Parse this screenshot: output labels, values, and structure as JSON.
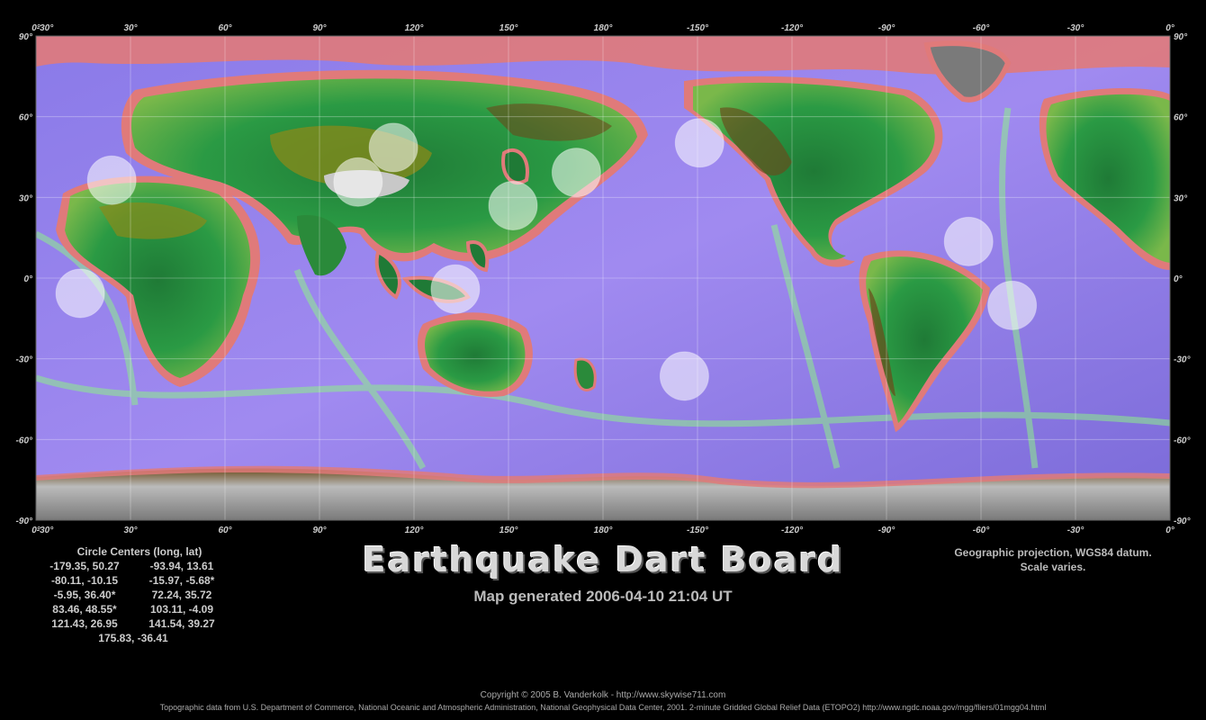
{
  "title": "Earthquake Dart Board",
  "subtitle": "Map generated 2006-04-10 21:04 UT",
  "projection_note": [
    "Geographic projection, WGS84 datum.",
    "Scale varies."
  ],
  "copyright": "Copyright © 2005 B. Vanderkolk - http://www.skywise711.com",
  "credits": "Topographic data from U.S. Department of Commerce, National Oceanic and Atmospheric Administration, National Geophysical Data Center, 2001. 2-minute Gridded Global Relief Data (ETOPO2) http://www.ngdc.noaa.gov/mgg/fliers/01mgg04.html",
  "map": {
    "longitude_ticks": [
      "-30°",
      "0°",
      "30°",
      "60°",
      "90°",
      "120°",
      "150°",
      "180°",
      "-150°",
      "-120°",
      "-90°",
      "-60°",
      "-30°",
      "0°",
      "30°"
    ],
    "latitude_ticks": [
      "90°",
      "60°",
      "30°",
      "0°",
      "-30°",
      "-60°",
      "-90°"
    ],
    "colors": {
      "ocean_deep": "#7a6ae0",
      "ocean_mid": "#a88ae8",
      "shelf": "#8ef08a",
      "coast": "#e07a7a",
      "lowland": "#1a8a3a",
      "upland": "#8a8a1a",
      "mountain": "#6a4a1a",
      "ice": "#9a9a9a",
      "circle_fill": "#ffffff"
    },
    "circles": [
      {
        "lon": -179.35,
        "lat": 50.27
      },
      {
        "lon": -93.94,
        "lat": 13.61
      },
      {
        "lon": -80.11,
        "lat": -10.15
      },
      {
        "lon": -15.97,
        "lat": -5.68
      },
      {
        "lon": -5.95,
        "lat": 36.4
      },
      {
        "lon": 72.24,
        "lat": 35.72
      },
      {
        "lon": 83.46,
        "lat": 48.55
      },
      {
        "lon": 103.11,
        "lat": -4.09
      },
      {
        "lon": 121.43,
        "lat": 26.95
      },
      {
        "lon": 141.54,
        "lat": 39.27
      },
      {
        "lon": 175.83,
        "lat": -36.41
      }
    ]
  },
  "centers": {
    "heading": "Circle Centers (long, lat)",
    "rows": [
      [
        "-179.35,  50.27",
        "-93.94,  13.61"
      ],
      [
        "-80.11, -10.15",
        "-15.97,  -5.68*"
      ],
      [
        "-5.95,  36.40*",
        "72.24,  35.72"
      ],
      [
        "83.46,  48.55*",
        "103.11,  -4.09"
      ],
      [
        "121.43,  26.95",
        "141.54,  39.27"
      ]
    ],
    "last": "175.83, -36.41"
  }
}
